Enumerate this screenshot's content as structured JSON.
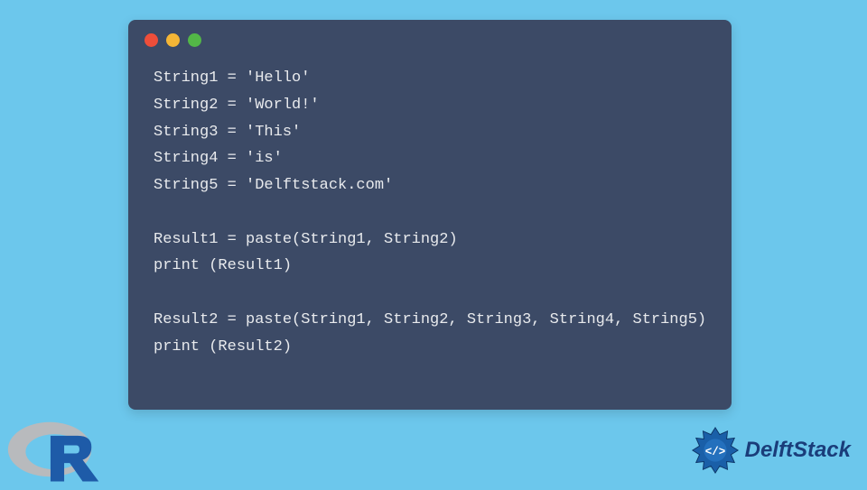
{
  "code": {
    "lines": [
      "String1 = 'Hello'",
      "String2 = 'World!'",
      "String3 = 'This'",
      "String4 = 'is'",
      "String5 = 'Delftstack.com'",
      "",
      "Result1 = paste(String1, String2)",
      "print (Result1)",
      "",
      "Result2 = paste(String1, String2, String3, String4, String5)",
      "print (Result2)"
    ]
  },
  "branding": {
    "delftstack_label": "DelftStack"
  },
  "window": {
    "controls": [
      "close",
      "minimize",
      "maximize"
    ]
  }
}
